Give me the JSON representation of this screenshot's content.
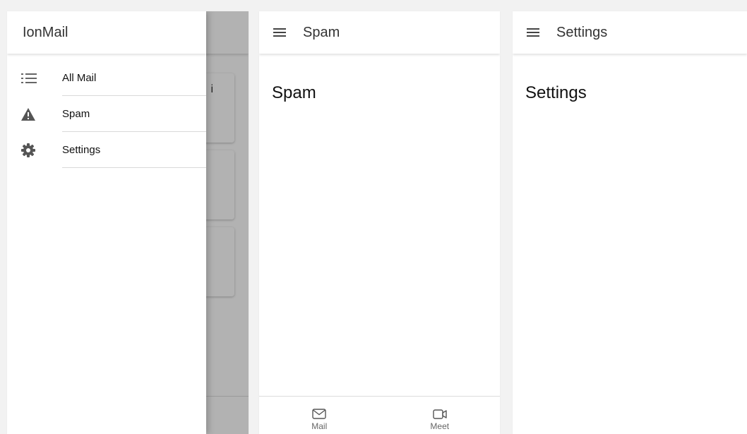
{
  "app": {
    "name": "IonMail"
  },
  "menu": {
    "items": [
      {
        "label": "All Mail",
        "icon": "list-icon"
      },
      {
        "label": "Spam",
        "icon": "warning-icon"
      },
      {
        "label": "Settings",
        "icon": "gear-icon"
      }
    ]
  },
  "spam_page": {
    "toolbar_title": "Spam",
    "content_title": "Spam",
    "tabs": [
      {
        "label": "Mail",
        "icon": "mail-icon"
      },
      {
        "label": "Meet",
        "icon": "video-icon"
      }
    ]
  },
  "settings_page": {
    "toolbar_title": "Settings",
    "content_title": "Settings"
  },
  "colors": {
    "icon": "#666666",
    "text": "#111111",
    "overlay": "rgba(0,0,0,0.30)"
  }
}
